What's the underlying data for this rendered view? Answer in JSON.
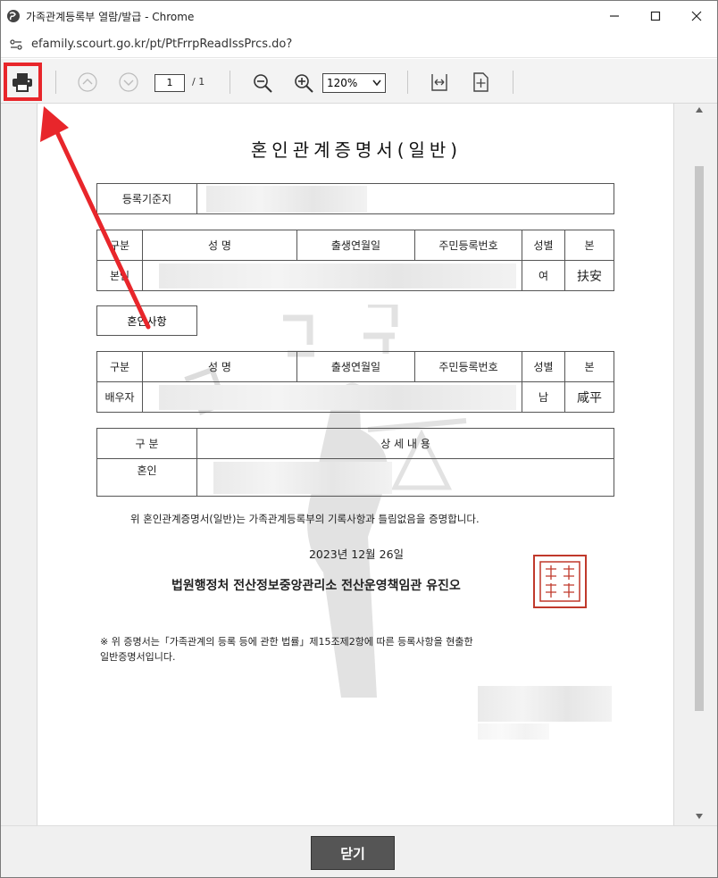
{
  "window": {
    "title": "가족관계등록부 열람/발급 - Chrome"
  },
  "address": {
    "url": "efamily.scourt.go.kr/pt/PtFrrpReadIssPrcs.do?"
  },
  "toolbar": {
    "page_current": "1",
    "page_total": "/ 1",
    "zoom": "120%"
  },
  "document": {
    "title": "혼인관계증명서(일반)",
    "registry_label": "등록기준지",
    "table1": {
      "headers": [
        "구분",
        "성    명",
        "출생연월일",
        "주민등록번호",
        "성별",
        "본"
      ],
      "row": {
        "label": "본인",
        "gender": "여",
        "origin": "扶安"
      }
    },
    "section_label": "혼인사항",
    "table2": {
      "headers": [
        "구분",
        "성    명",
        "출생연월일",
        "주민등록번호",
        "성별",
        "본"
      ],
      "row": {
        "label": "배우자",
        "gender": "남",
        "origin": "咸平"
      }
    },
    "table3": {
      "headers": [
        "구  분",
        "상  세  내  용"
      ],
      "row_label": "혼인"
    },
    "certify": "위 혼인관계증명서(일반)는 가족관계등록부의 기록사항과 틀림없음을 증명합니다.",
    "date": "2023년  12월  26일",
    "issuer": "법원행정처 전산정보중앙관리소 전산운영책임관 유진오",
    "note_line1": "※ 위 증명서는「가족관계의 등록 등에 관한 법률」제15조제2항에 따른 등록사항을 현출한",
    "note_line2": "일반증명서입니다."
  },
  "footer": {
    "close_label": "닫기"
  },
  "colors": {
    "highlight": "#e8262b",
    "seal": "#c0392b",
    "close_bg": "#555555"
  }
}
